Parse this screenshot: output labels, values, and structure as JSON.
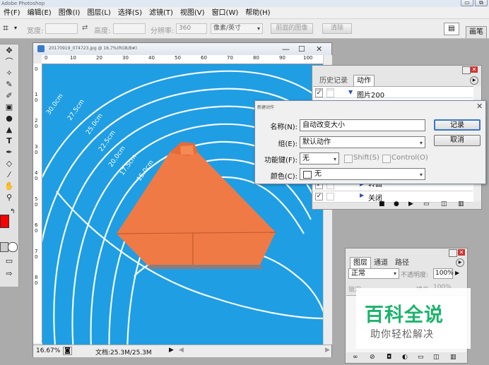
{
  "app": {
    "title": "Adobe Photoshop",
    "window_controls": [
      "▭",
      "⧉"
    ]
  },
  "menu": [
    "件(F)",
    "编辑(E)",
    "图像(I)",
    "图层(L)",
    "选择(S)",
    "滤镜(T)",
    "视图(V)",
    "窗口(W)",
    "帮助(H)"
  ],
  "options": {
    "width_label": "宽度:",
    "height_label": "高度:",
    "resolution_label": "分辨率:",
    "resolution_value": "360",
    "unit_value": "像素/英寸",
    "front_image_button": "前面的图像",
    "clear_button": "清除",
    "palette_tab": "画笔"
  },
  "document": {
    "title": "20170919_074723.jpg @ 16.7%(RGB/8#)",
    "zoom": "16.67%",
    "doc_size": "文档:25.3M/25.3M",
    "ruler_h_ticks": [
      "0",
      "10",
      "20",
      "30",
      "40",
      "50",
      "60",
      "70",
      "80",
      "90",
      "100"
    ],
    "ruler_v_ticks": [
      "0",
      "1 0",
      "2 0",
      "3 0",
      "4 0",
      "5 0",
      "6 0",
      "7 0",
      "8 0"
    ],
    "mat_labels": [
      "30.0cm",
      "27.5cm",
      "25.0cm",
      "22.5cm",
      "20.0cm",
      "17.5cm",
      "15.0cm"
    ]
  },
  "actions_panel": {
    "tabs": [
      "历史记录",
      "动作"
    ],
    "rows": [
      {
        "label": "",
        "checked": true
      },
      {
        "label": "图片200",
        "checked": true
      },
      {
        "label": "转曲",
        "checked": true
      },
      {
        "label": "关闭",
        "checked": true
      }
    ]
  },
  "dialog": {
    "title": "新建动作",
    "name_label": "名称(N):",
    "name_value": "自动改变大小",
    "set_label": "组(E):",
    "set_value": "默认动作",
    "fkey_label": "功能键(F):",
    "fkey_value": "无",
    "shift_label": "Shift(S)",
    "control_label": "Control(O)",
    "color_label": "颜色(C):",
    "color_value": "无",
    "record_button": "记录",
    "cancel_button": "取消"
  },
  "layers_panel": {
    "tabs": [
      "图层",
      "通道",
      "路径"
    ],
    "blend_mode": "正常",
    "opacity_label": "不透明度:",
    "opacity_value": "100%",
    "lock_label": "锁定:",
    "fill_label": "填充:",
    "fill_value": "100%"
  },
  "watermark": {
    "title": "百科全说",
    "subtitle": "助你轻松解决"
  },
  "colors": {
    "foreground": "#ff0000",
    "background": "#ffffff",
    "canvas_blue": "#1f9ee3",
    "paper_orange": "#f07a45",
    "watermark_green": "#1db36c"
  }
}
